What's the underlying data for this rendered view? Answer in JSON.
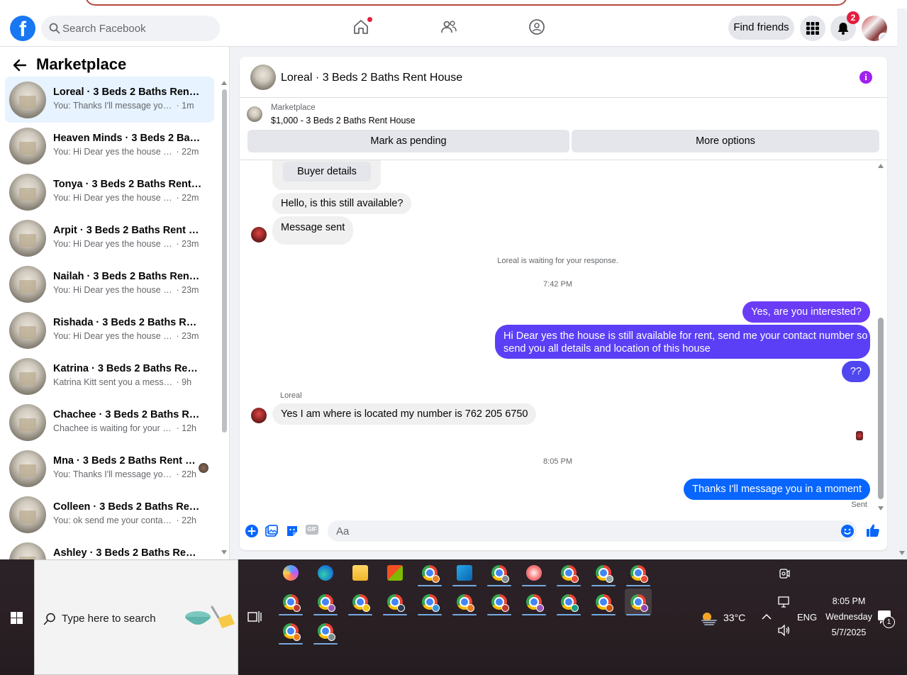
{
  "topnav": {
    "search_placeholder": "Search Facebook",
    "find_friends_label": "Find friends",
    "notifications_badge": "2",
    "icons": [
      "facebook-logo",
      "home-icon",
      "friends-icon",
      "groups-icon",
      "menu-grid-icon",
      "bell-icon",
      "profile-avatar"
    ]
  },
  "sidebar": {
    "title": "Marketplace",
    "conversations": [
      {
        "title": "Loreal · 3 Beds 2 Baths Rent Ho...",
        "preview": "You: Thanks I'll message you in a ...",
        "time": "· 1m",
        "active": true
      },
      {
        "title": "Heaven Minds · 3 Beds 2 Baths ...",
        "preview": "You: Hi Dear yes the house is still ...",
        "time": "· 22m"
      },
      {
        "title": "Tonya · 3 Beds 2 Baths Rent Hou...",
        "preview": "You: Hi Dear yes the house is still ...",
        "time": "· 22m"
      },
      {
        "title": "Arpit · 3 Beds 2 Baths Rent House",
        "preview": "You: Hi Dear yes the house is still ...",
        "time": "· 23m"
      },
      {
        "title": "Nailah · 3 Beds 2 Baths Rent Ho...",
        "preview": "You: Hi Dear yes the house is still ...",
        "time": "· 23m"
      },
      {
        "title": "Rishada · 3 Beds 2 Baths Rent H...",
        "preview": "You: Hi Dear yes the house is still ...",
        "time": "· 23m"
      },
      {
        "title": "Katrina · 3 Beds 2 Baths Rent Ho...",
        "preview": "Katrina Kitt sent you a message ab...",
        "time": "· 9h"
      },
      {
        "title": "Chachee · 3 Beds 2 Baths Rent H...",
        "preview": "Chachee is waiting for your respo...",
        "time": "· 12h"
      },
      {
        "title": "Mna · 3 Beds 2 Baths Rent Ho...",
        "preview": "You: Thanks I'll message you in...",
        "time": "· 22h",
        "seen": true
      },
      {
        "title": "Colleen · 3 Beds 2 Baths Rent H...",
        "preview": "You: ok send me your contact nu...",
        "time": "· 22h"
      },
      {
        "title": "Ashley · 3 Beds 2 Baths Rent Ho...",
        "preview": "",
        "time": ""
      }
    ]
  },
  "chat": {
    "title": "Loreal · 3 Beds 2 Baths Rent House",
    "listing_source": "Marketplace",
    "listing_price": "$1,000 - 3 Beds 2 Baths Rent House",
    "mark_pending_label": "Mark as pending",
    "more_options_label": "More options",
    "buyer_details_label": "Buyer details",
    "msg_in_1": "Hello, is this still available?",
    "msg_in_2": "Message sent",
    "waiting_note": "Loreal is waiting for your response.",
    "time_1": "7:42 PM",
    "msg_out_1": "Yes, are you interested?",
    "msg_out_2_line1": "Hi Dear yes the house is still available for rent, send me your contact number so i can",
    "msg_out_2_line2": "send you all details and location of this house",
    "msg_out_3": "??",
    "sender_name": "Loreal",
    "msg_in_3": "Yes I am where is located my number is 762 205 6750",
    "time_2": "8:05 PM",
    "msg_out_4": "Thanks I'll message you in a moment",
    "status": "Sent",
    "composer_placeholder": "Aa",
    "gif_label": "GIF",
    "colors": {
      "accent_purple": "#6b3cf5",
      "accent_blue": "#0866ff",
      "info_icon": "#a020f0"
    }
  },
  "taskbar": {
    "search_placeholder": "Type here to search",
    "weather": "33°C",
    "lang": "ENG",
    "time": "8:05 PM",
    "day": "Wednesday",
    "date": "5/7/2025",
    "notification_count": "1"
  }
}
